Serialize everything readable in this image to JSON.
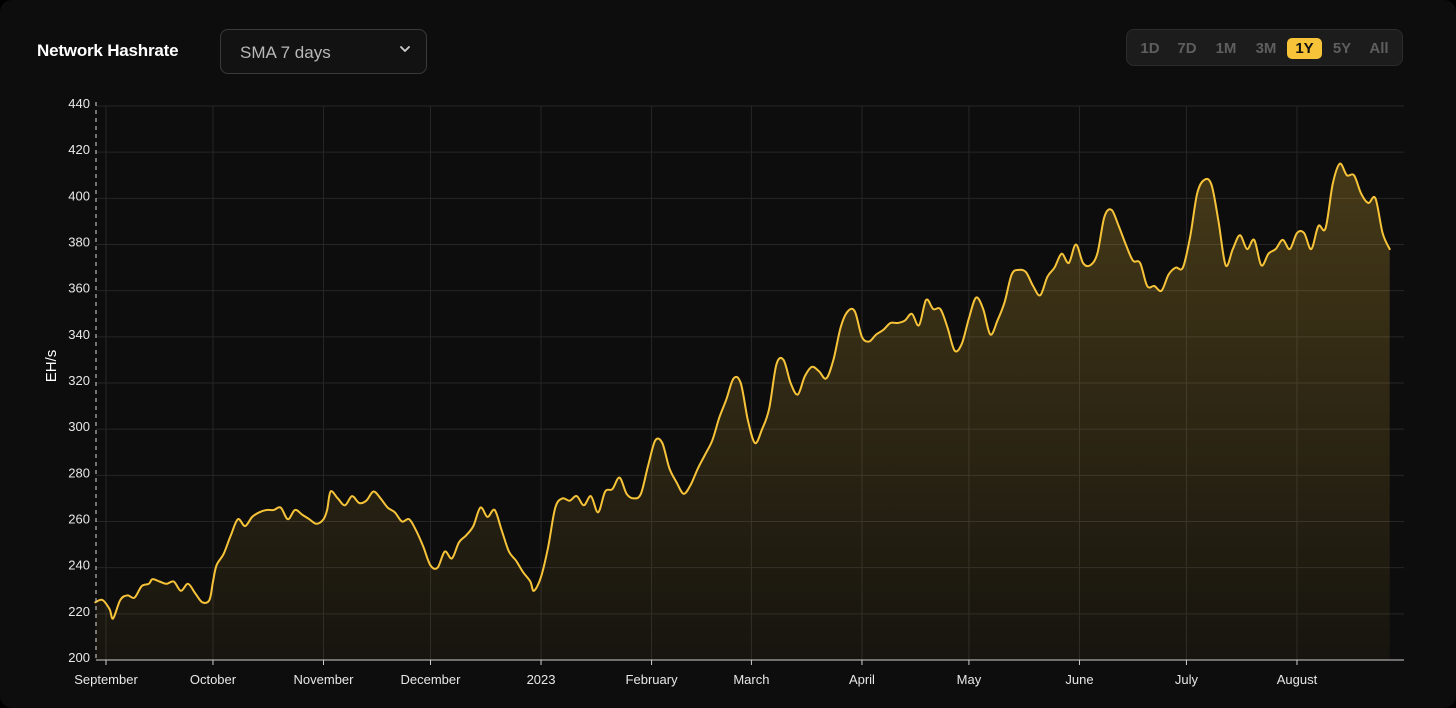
{
  "header": {
    "title": "Network Hashrate",
    "sma_select": {
      "value": "SMA 7 days"
    }
  },
  "range_buttons": [
    {
      "label": "1D",
      "active": false
    },
    {
      "label": "7D",
      "active": false
    },
    {
      "label": "1M",
      "active": false
    },
    {
      "label": "3M",
      "active": false
    },
    {
      "label": "1Y",
      "active": true
    },
    {
      "label": "5Y",
      "active": false
    },
    {
      "label": "All",
      "active": false
    }
  ],
  "colors": {
    "line": "#f7c439",
    "grid": "#262626",
    "background": "#0d0d0d",
    "active_button": "#f7c439"
  },
  "chart_data": {
    "type": "area",
    "title": "Network Hashrate",
    "ylabel": "EH/s",
    "xlabel": "",
    "ylim": [
      200,
      440
    ],
    "yticks": [
      200,
      220,
      240,
      260,
      280,
      300,
      320,
      340,
      360,
      380,
      400,
      420,
      440
    ],
    "x_start": "2022-09-01",
    "x_end": "2023-08-28",
    "x_tick_labels": [
      {
        "date": "2022-09-01",
        "label": "September"
      },
      {
        "date": "2022-10-01",
        "label": "October"
      },
      {
        "date": "2022-11-01",
        "label": "November"
      },
      {
        "date": "2022-12-01",
        "label": "December"
      },
      {
        "date": "2023-01-01",
        "label": "2023"
      },
      {
        "date": "2023-02-01",
        "label": "February"
      },
      {
        "date": "2023-03-01",
        "label": "March"
      },
      {
        "date": "2023-04-01",
        "label": "April"
      },
      {
        "date": "2023-05-01",
        "label": "May"
      },
      {
        "date": "2023-06-01",
        "label": "June"
      },
      {
        "date": "2023-07-01",
        "label": "July"
      },
      {
        "date": "2023-08-01",
        "label": "August"
      }
    ],
    "grid": true,
    "legend": "none",
    "series": [
      {
        "values": [
          [
            "2022-08-29",
            225
          ],
          [
            "2022-08-31",
            226
          ],
          [
            "2022-09-02",
            222
          ],
          [
            "2022-09-03",
            218
          ],
          [
            "2022-09-05",
            226
          ],
          [
            "2022-09-07",
            228
          ],
          [
            "2022-09-09",
            227
          ],
          [
            "2022-09-11",
            232
          ],
          [
            "2022-09-13",
            233
          ],
          [
            "2022-09-14",
            235
          ],
          [
            "2022-09-16",
            234
          ],
          [
            "2022-09-18",
            233
          ],
          [
            "2022-09-20",
            234
          ],
          [
            "2022-09-22",
            230
          ],
          [
            "2022-09-24",
            233
          ],
          [
            "2022-09-26",
            229
          ],
          [
            "2022-09-28",
            225
          ],
          [
            "2022-09-30",
            226
          ],
          [
            "2022-10-01",
            234
          ],
          [
            "2022-10-02",
            241
          ],
          [
            "2022-10-04",
            246
          ],
          [
            "2022-10-06",
            254
          ],
          [
            "2022-10-08",
            261
          ],
          [
            "2022-10-10",
            258
          ],
          [
            "2022-10-12",
            262
          ],
          [
            "2022-10-14",
            264
          ],
          [
            "2022-10-16",
            265
          ],
          [
            "2022-10-18",
            265
          ],
          [
            "2022-10-20",
            266
          ],
          [
            "2022-10-22",
            261
          ],
          [
            "2022-10-24",
            265
          ],
          [
            "2022-10-26",
            263
          ],
          [
            "2022-10-28",
            261
          ],
          [
            "2022-10-30",
            259
          ],
          [
            "2022-11-01",
            261
          ],
          [
            "2022-11-02",
            265
          ],
          [
            "2022-11-03",
            273
          ],
          [
            "2022-11-05",
            270
          ],
          [
            "2022-11-07",
            267
          ],
          [
            "2022-11-09",
            271
          ],
          [
            "2022-11-11",
            268
          ],
          [
            "2022-11-13",
            269
          ],
          [
            "2022-11-15",
            273
          ],
          [
            "2022-11-17",
            270
          ],
          [
            "2022-11-19",
            266
          ],
          [
            "2022-11-21",
            264
          ],
          [
            "2022-11-23",
            260
          ],
          [
            "2022-11-25",
            261
          ],
          [
            "2022-11-27",
            256
          ],
          [
            "2022-11-29",
            249
          ],
          [
            "2022-12-01",
            241
          ],
          [
            "2022-12-03",
            240
          ],
          [
            "2022-12-05",
            247
          ],
          [
            "2022-12-07",
            244
          ],
          [
            "2022-12-09",
            251
          ],
          [
            "2022-12-11",
            254
          ],
          [
            "2022-12-13",
            258
          ],
          [
            "2022-12-15",
            266
          ],
          [
            "2022-12-17",
            262
          ],
          [
            "2022-12-19",
            265
          ],
          [
            "2022-12-21",
            256
          ],
          [
            "2022-12-23",
            247
          ],
          [
            "2022-12-25",
            243
          ],
          [
            "2022-12-27",
            238
          ],
          [
            "2022-12-29",
            234
          ],
          [
            "2022-12-30",
            230
          ],
          [
            "2023-01-01",
            236
          ],
          [
            "2023-01-03",
            249
          ],
          [
            "2023-01-05",
            266
          ],
          [
            "2023-01-07",
            270
          ],
          [
            "2023-01-09",
            269
          ],
          [
            "2023-01-11",
            271
          ],
          [
            "2023-01-13",
            267
          ],
          [
            "2023-01-15",
            271
          ],
          [
            "2023-01-17",
            264
          ],
          [
            "2023-01-19",
            273
          ],
          [
            "2023-01-21",
            274
          ],
          [
            "2023-01-23",
            279
          ],
          [
            "2023-01-25",
            272
          ],
          [
            "2023-01-27",
            270
          ],
          [
            "2023-01-29",
            272
          ],
          [
            "2023-01-31",
            284
          ],
          [
            "2023-02-02",
            295
          ],
          [
            "2023-02-04",
            294
          ],
          [
            "2023-02-06",
            283
          ],
          [
            "2023-02-08",
            277
          ],
          [
            "2023-02-10",
            272
          ],
          [
            "2023-02-12",
            276
          ],
          [
            "2023-02-14",
            283
          ],
          [
            "2023-02-16",
            289
          ],
          [
            "2023-02-18",
            295
          ],
          [
            "2023-02-20",
            305
          ],
          [
            "2023-02-22",
            313
          ],
          [
            "2023-02-24",
            322
          ],
          [
            "2023-02-26",
            320
          ],
          [
            "2023-02-28",
            304
          ],
          [
            "2023-03-02",
            294
          ],
          [
            "2023-03-04",
            300
          ],
          [
            "2023-03-06",
            309
          ],
          [
            "2023-03-08",
            328
          ],
          [
            "2023-03-10",
            330
          ],
          [
            "2023-03-12",
            320
          ],
          [
            "2023-03-14",
            315
          ],
          [
            "2023-03-16",
            323
          ],
          [
            "2023-03-18",
            327
          ],
          [
            "2023-03-20",
            325
          ],
          [
            "2023-03-22",
            322
          ],
          [
            "2023-03-24",
            330
          ],
          [
            "2023-03-26",
            344
          ],
          [
            "2023-03-28",
            351
          ],
          [
            "2023-03-30",
            351
          ],
          [
            "2023-04-01",
            340
          ],
          [
            "2023-04-03",
            338
          ],
          [
            "2023-04-05",
            341
          ],
          [
            "2023-04-07",
            343
          ],
          [
            "2023-04-09",
            346
          ],
          [
            "2023-04-11",
            346
          ],
          [
            "2023-04-13",
            347
          ],
          [
            "2023-04-15",
            350
          ],
          [
            "2023-04-17",
            345
          ],
          [
            "2023-04-19",
            356
          ],
          [
            "2023-04-21",
            352
          ],
          [
            "2023-04-23",
            352
          ],
          [
            "2023-04-25",
            344
          ],
          [
            "2023-04-27",
            334
          ],
          [
            "2023-04-29",
            337
          ],
          [
            "2023-05-01",
            348
          ],
          [
            "2023-05-03",
            357
          ],
          [
            "2023-05-05",
            352
          ],
          [
            "2023-05-07",
            341
          ],
          [
            "2023-05-09",
            347
          ],
          [
            "2023-05-11",
            355
          ],
          [
            "2023-05-13",
            367
          ],
          [
            "2023-05-15",
            369
          ],
          [
            "2023-05-17",
            368
          ],
          [
            "2023-05-19",
            362
          ],
          [
            "2023-05-21",
            358
          ],
          [
            "2023-05-23",
            366
          ],
          [
            "2023-05-25",
            370
          ],
          [
            "2023-05-27",
            376
          ],
          [
            "2023-05-29",
            372
          ],
          [
            "2023-05-31",
            380
          ],
          [
            "2023-06-02",
            372
          ],
          [
            "2023-06-04",
            371
          ],
          [
            "2023-06-06",
            376
          ],
          [
            "2023-06-08",
            392
          ],
          [
            "2023-06-10",
            395
          ],
          [
            "2023-06-12",
            388
          ],
          [
            "2023-06-14",
            380
          ],
          [
            "2023-06-16",
            373
          ],
          [
            "2023-06-18",
            372
          ],
          [
            "2023-06-20",
            362
          ],
          [
            "2023-06-22",
            362
          ],
          [
            "2023-06-24",
            360
          ],
          [
            "2023-06-26",
            367
          ],
          [
            "2023-06-28",
            370
          ],
          [
            "2023-06-30",
            370
          ],
          [
            "2023-07-02",
            383
          ],
          [
            "2023-07-04",
            402
          ],
          [
            "2023-07-06",
            408
          ],
          [
            "2023-07-08",
            406
          ],
          [
            "2023-07-10",
            390
          ],
          [
            "2023-07-12",
            371
          ],
          [
            "2023-07-14",
            378
          ],
          [
            "2023-07-16",
            384
          ],
          [
            "2023-07-18",
            378
          ],
          [
            "2023-07-20",
            382
          ],
          [
            "2023-07-22",
            371
          ],
          [
            "2023-07-24",
            376
          ],
          [
            "2023-07-26",
            378
          ],
          [
            "2023-07-28",
            382
          ],
          [
            "2023-07-30",
            378
          ],
          [
            "2023-08-01",
            385
          ],
          [
            "2023-08-03",
            385
          ],
          [
            "2023-08-05",
            378
          ],
          [
            "2023-08-07",
            388
          ],
          [
            "2023-08-09",
            387
          ],
          [
            "2023-08-11",
            406
          ],
          [
            "2023-08-13",
            415
          ],
          [
            "2023-08-15",
            410
          ],
          [
            "2023-08-17",
            410
          ],
          [
            "2023-08-19",
            402
          ],
          [
            "2023-08-21",
            398
          ],
          [
            "2023-08-23",
            400
          ],
          [
            "2023-08-25",
            385
          ],
          [
            "2023-08-27",
            378
          ]
        ]
      }
    ]
  }
}
